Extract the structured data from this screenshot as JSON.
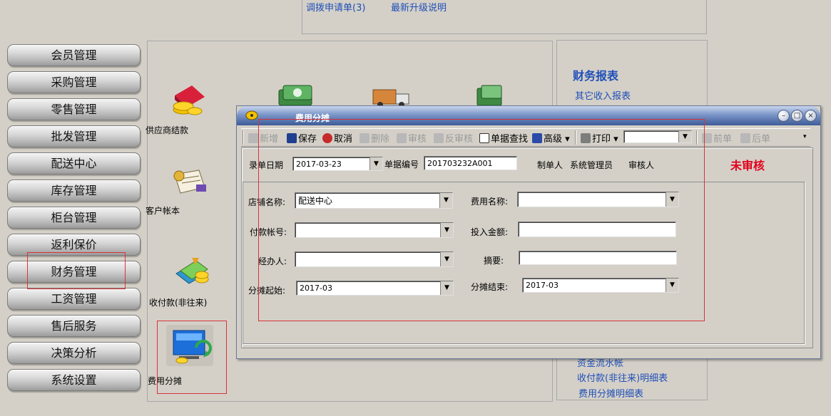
{
  "top_links": [
    "调拨申请单(3)",
    "最新升级说明"
  ],
  "nav_items": [
    "会员管理",
    "采购管理",
    "零售管理",
    "批发管理",
    "配送中心",
    "库存管理",
    "柜台管理",
    "返利保价",
    "财务管理",
    "工资管理",
    "售后服务",
    "决策分析",
    "系统设置"
  ],
  "modules": [
    "供应商结款",
    "客户帐本",
    "收付款(非往来)",
    "费用分摊"
  ],
  "right_panel": {
    "title": "财务报表",
    "links_top": [
      "其它收入报表"
    ],
    "links_bottom": [
      "资金流水帐",
      "收付款(非往来)明细表",
      "费用分摊明细表"
    ]
  },
  "dialog": {
    "title": "费用分摊",
    "window_buttons": [
      "minimize-icon",
      "maximize-icon",
      "close-icon"
    ],
    "toolbar": {
      "new": "新增",
      "save": "保存",
      "cancel": "取消",
      "delete": "删除",
      "audit": "审核",
      "unaudit": "反审核",
      "find": "单据查找",
      "advanced": "高级",
      "print": "打印",
      "prev": "前单",
      "next": "后单"
    },
    "header": {
      "date_label": "录单日期",
      "date_value": "2017-03-23",
      "docno_label": "单据编号",
      "docno_value": "201703232A001",
      "maker_label": "制单人",
      "maker_value": "系统管理员",
      "reviewer_label": "审核人",
      "status": "未审核"
    },
    "form": {
      "store_label": "店铺名称:",
      "store_value": "配送中心",
      "expense_label": "费用名称:",
      "expense_value": "",
      "account_label": "付款帐号:",
      "account_value": "",
      "amount_label": "投入金额:",
      "amount_value": "",
      "handler_label": "经办人:",
      "handler_value": "",
      "summary_label": "摘要:",
      "summary_value": "",
      "start_label": "分摊起始:",
      "start_value": "2017-03",
      "end_label": "分摊结束:",
      "end_value": "2017-03"
    }
  },
  "colors": {
    "status_red": "#e3001b",
    "link_blue": "#1f4fb8",
    "highlight": "#d8333a"
  }
}
